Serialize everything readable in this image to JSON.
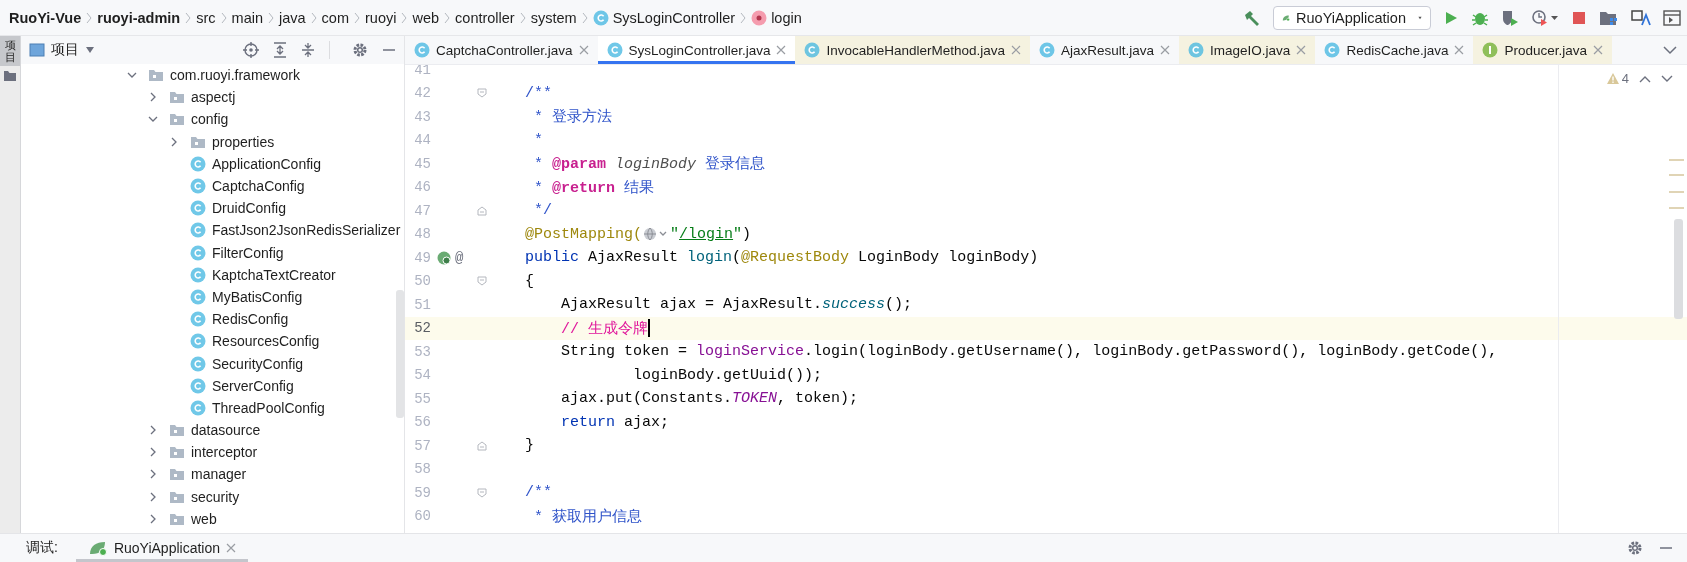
{
  "breadcrumbs": [
    {
      "label": "RuoYi-Vue",
      "kind": "module"
    },
    {
      "label": "ruoyi-admin",
      "kind": "module"
    },
    {
      "label": "src",
      "kind": "folder"
    },
    {
      "label": "main",
      "kind": "folder"
    },
    {
      "label": "java",
      "kind": "folder"
    },
    {
      "label": "com",
      "kind": "folder"
    },
    {
      "label": "ruoyi",
      "kind": "folder"
    },
    {
      "label": "web",
      "kind": "folder"
    },
    {
      "label": "controller",
      "kind": "folder"
    },
    {
      "label": "system",
      "kind": "folder"
    },
    {
      "label": "SysLoginController",
      "kind": "class"
    },
    {
      "label": "login",
      "kind": "method"
    }
  ],
  "run_config": {
    "label": "RuoYiApplication"
  },
  "side_strip": {
    "label": "项目"
  },
  "project_panel": {
    "title": "项目",
    "tree": [
      {
        "label": "com.ruoyi.framework",
        "kind": "package",
        "expanded": true,
        "children": [
          {
            "label": "aspectj",
            "kind": "package",
            "expanded": false
          },
          {
            "label": "config",
            "kind": "package",
            "expanded": true,
            "children": [
              {
                "label": "properties",
                "kind": "package",
                "expanded": false
              },
              {
                "label": "ApplicationConfig",
                "kind": "class"
              },
              {
                "label": "CaptchaConfig",
                "kind": "class"
              },
              {
                "label": "DruidConfig",
                "kind": "class"
              },
              {
                "label": "FastJson2JsonRedisSerializer",
                "kind": "class"
              },
              {
                "label": "FilterConfig",
                "kind": "class"
              },
              {
                "label": "KaptchaTextCreator",
                "kind": "class"
              },
              {
                "label": "MyBatisConfig",
                "kind": "class"
              },
              {
                "label": "RedisConfig",
                "kind": "class"
              },
              {
                "label": "ResourcesConfig",
                "kind": "class"
              },
              {
                "label": "SecurityConfig",
                "kind": "class"
              },
              {
                "label": "ServerConfig",
                "kind": "class"
              },
              {
                "label": "ThreadPoolConfig",
                "kind": "class"
              }
            ]
          },
          {
            "label": "datasource",
            "kind": "package",
            "expanded": false
          },
          {
            "label": "interceptor",
            "kind": "package",
            "expanded": false
          },
          {
            "label": "manager",
            "kind": "package",
            "expanded": false
          },
          {
            "label": "security",
            "kind": "package",
            "expanded": false
          },
          {
            "label": "web",
            "kind": "package",
            "expanded": false
          }
        ]
      }
    ]
  },
  "editor_tabs": [
    {
      "label": "CaptchaController.java",
      "kind": "class",
      "library": false,
      "selected": false
    },
    {
      "label": "SysLoginController.java",
      "kind": "class",
      "library": false,
      "selected": true
    },
    {
      "label": "InvocableHandlerMethod.java",
      "kind": "class",
      "library": true,
      "selected": false
    },
    {
      "label": "AjaxResult.java",
      "kind": "class",
      "library": false,
      "selected": false
    },
    {
      "label": "ImageIO.java",
      "kind": "class",
      "library": true,
      "selected": false
    },
    {
      "label": "RedisCache.java",
      "kind": "class",
      "library": false,
      "selected": false
    },
    {
      "label": "Producer.java",
      "kind": "interface",
      "library": true,
      "selected": false
    }
  ],
  "inspections": {
    "warnings": "4"
  },
  "code": [
    {
      "number": "41",
      "current": false,
      "fold_start": false,
      "fold_end": false
    },
    {
      "number": "42",
      "current": false,
      "fold_start": true,
      "fold_end": false,
      "tokens": [
        {
          "text": "    /**",
          "kind": "doc"
        }
      ]
    },
    {
      "number": "43",
      "current": false,
      "fold_start": false,
      "fold_end": false,
      "tokens": [
        {
          "text": "     * 登录方法",
          "kind": "doc"
        }
      ]
    },
    {
      "number": "44",
      "current": false,
      "fold_start": false,
      "fold_end": false,
      "tokens": [
        {
          "text": "     *",
          "kind": "doc"
        }
      ]
    },
    {
      "number": "45",
      "current": false,
      "fold_start": false,
      "fold_end": false,
      "tokens": [
        {
          "text": "     * ",
          "kind": "doc"
        },
        {
          "text": "@param",
          "kind": "doctag"
        },
        {
          "text": " loginBody",
          "kind": "docparam"
        },
        {
          "text": " 登录信息",
          "kind": "doc"
        }
      ]
    },
    {
      "number": "46",
      "current": false,
      "fold_start": false,
      "fold_end": false,
      "tokens": [
        {
          "text": "     * ",
          "kind": "doc"
        },
        {
          "text": "@return",
          "kind": "doctag"
        },
        {
          "text": " 结果",
          "kind": "doc"
        }
      ]
    },
    {
      "number": "47",
      "current": false,
      "fold_start": false,
      "fold_end": true,
      "tokens": [
        {
          "text": "     */",
          "kind": "doc"
        }
      ]
    },
    {
      "number": "48",
      "current": false,
      "fold_start": false,
      "fold_end": false,
      "tokens": [
        {
          "text": "    @PostMapping(",
          "kind": "annotation"
        },
        {
          "kind": "globe-inlay"
        },
        {
          "text": "\"",
          "kind": "string"
        },
        {
          "text": "/login",
          "kind": "link"
        },
        {
          "text": "\"",
          "kind": "string"
        },
        {
          "text": ")",
          "kind": "plain"
        }
      ]
    },
    {
      "number": "49",
      "current": false,
      "fold_start": false,
      "fold_end": false,
      "gutter_icons": [
        {
          "kind": "bean"
        },
        {
          "kind": "mapping",
          "text": "@"
        }
      ],
      "tokens": [
        {
          "text": "    public",
          "kind": "keyword"
        },
        {
          "text": " AjaxResult ",
          "kind": "plain"
        },
        {
          "text": "login",
          "kind": "method-decl"
        },
        {
          "text": "(",
          "kind": "plain"
        },
        {
          "text": "@RequestBody",
          "kind": "annotation"
        },
        {
          "text": " LoginBody loginBody)",
          "kind": "plain"
        }
      ]
    },
    {
      "number": "50",
      "current": false,
      "fold_start": true,
      "fold_end": false,
      "tokens": [
        {
          "text": "    {",
          "kind": "plain"
        }
      ]
    },
    {
      "number": "51",
      "current": false,
      "fold_start": false,
      "fold_end": false,
      "tokens": [
        {
          "text": "        AjaxResult ajax = AjaxResult.",
          "kind": "plain"
        },
        {
          "text": "success",
          "kind": "static-call"
        },
        {
          "text": "();",
          "kind": "plain"
        }
      ]
    },
    {
      "number": "52",
      "current": true,
      "fold_start": false,
      "fold_end": false,
      "tokens": [
        {
          "text": "        // 生成令牌",
          "kind": "comment"
        }
      ]
    },
    {
      "number": "53",
      "current": false,
      "fold_start": false,
      "fold_end": false,
      "tokens": [
        {
          "text": "        String token = ",
          "kind": "plain"
        },
        {
          "text": "loginService",
          "kind": "field"
        },
        {
          "text": ".login(loginBody.getUsername(), loginBody.getPassword(), loginBody.getCode(),",
          "kind": "plain"
        }
      ]
    },
    {
      "number": "54",
      "current": false,
      "fold_start": false,
      "fold_end": false,
      "tokens": [
        {
          "text": "                loginBody.getUuid());",
          "kind": "plain"
        }
      ]
    },
    {
      "number": "55",
      "current": false,
      "fold_start": false,
      "fold_end": false,
      "tokens": [
        {
          "text": "        ajax.put(Constants.",
          "kind": "plain"
        },
        {
          "text": "TOKEN",
          "kind": "constant"
        },
        {
          "text": ", token);",
          "kind": "plain"
        }
      ]
    },
    {
      "number": "56",
      "current": false,
      "fold_start": false,
      "fold_end": false,
      "tokens": [
        {
          "text": "        return",
          "kind": "keyword"
        },
        {
          "text": " ajax;",
          "kind": "plain"
        }
      ]
    },
    {
      "number": "57",
      "current": false,
      "fold_start": false,
      "fold_end": true,
      "tokens": [
        {
          "text": "    }",
          "kind": "plain"
        }
      ]
    },
    {
      "number": "58",
      "current": false,
      "fold_start": false,
      "fold_end": false
    },
    {
      "number": "59",
      "current": false,
      "fold_start": true,
      "fold_end": false,
      "tokens": [
        {
          "text": "    /**",
          "kind": "doc"
        }
      ]
    },
    {
      "number": "60",
      "current": false,
      "fold_start": false,
      "fold_end": false,
      "tokens": [
        {
          "text": "     * 获取用户信息",
          "kind": "doc"
        }
      ]
    }
  ],
  "debug_bar": {
    "label": "调试:",
    "tabs": [
      {
        "label": "RuoYiApplication",
        "selected": true
      }
    ]
  }
}
